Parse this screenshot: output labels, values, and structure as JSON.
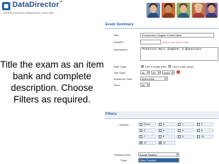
{
  "header": {
    "logo_text": "DataDirector",
    "logo_tm": "™",
    "tagline": "Achieving results by making sense of your data"
  },
  "caption": "Title the exam as an item bank and complete description. Choose Filters as required.",
  "exam_summary": {
    "title": "Exam Summary",
    "title_label": "Title:",
    "title_value": "Economics Chapter 4 Item Bank",
    "examid_label": "ExamID:",
    "examid_hint": "(optional, Item Number Only)",
    "description_label": "Description:",
    "description_value": "Prentice Hall Chapter 4 Questions",
    "date_type_label": "Date Type:",
    "single_date_label": "Use a single date",
    "date_range_label": "Use a date range",
    "test_date_label": "Test Date:",
    "test_month": "11",
    "test_day": "07",
    "test_year": "2010",
    "academic_year_label": "Academic Year:",
    "academic_year_value": "2010-2011",
    "term_label": "Term:",
    "term_value": "S1"
  },
  "filters": {
    "title": "Filters",
    "grades_label": "*Grades:",
    "grades": [
      {
        "label": "Pre-K",
        "checked": false
      },
      {
        "label": "K",
        "checked": false
      },
      {
        "label": "1",
        "checked": false
      },
      {
        "label": "2",
        "checked": false
      },
      {
        "label": "3",
        "checked": false
      },
      {
        "label": "4",
        "checked": false
      },
      {
        "label": "5",
        "checked": false
      },
      {
        "label": "6",
        "checked": false
      },
      {
        "label": "7",
        "checked": false
      },
      {
        "label": "8",
        "checked": false
      },
      {
        "label": "9",
        "checked": false
      },
      {
        "label": "10",
        "checked": false
      },
      {
        "label": "11",
        "checked": true
      },
      {
        "label": "12",
        "checked": true
      }
    ],
    "subject_area_label": "*Subject Area:",
    "subject_area_value": "Social Studies",
    "type_label": "*Type:",
    "type_value": "User-Created"
  },
  "colors": {
    "brand": "#2a63a8",
    "section_title": "#2a63a8",
    "type_highlight": "#2a63a8"
  }
}
